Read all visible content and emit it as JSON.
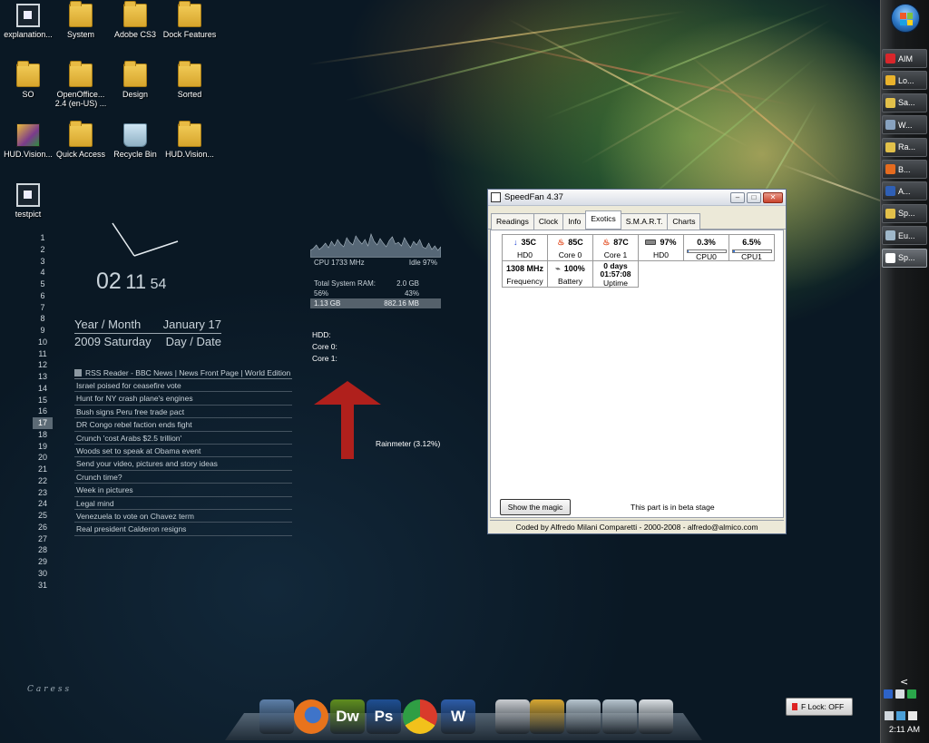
{
  "desktop_icons": [
    {
      "label": "explanation...",
      "type": "screen"
    },
    {
      "label": "System",
      "type": "folder"
    },
    {
      "label": "Adobe CS3",
      "type": "folder"
    },
    {
      "label": "Dock Features",
      "type": "folder"
    },
    {
      "label": "SO",
      "type": "folder"
    },
    {
      "label": "OpenOffice... 2.4 (en-US) ...",
      "type": "folder"
    },
    {
      "label": "Design",
      "type": "folder"
    },
    {
      "label": "Sorted",
      "type": "folder"
    },
    {
      "label": "HUD.Vision...",
      "type": "hud"
    },
    {
      "label": "Quick Access",
      "type": "folder"
    },
    {
      "label": "Recycle Bin",
      "type": "bin"
    },
    {
      "label": "HUD.Vision...",
      "type": "folder"
    },
    {
      "label": "testpict",
      "type": "screen"
    }
  ],
  "calendar": {
    "days": [
      "1",
      "2",
      "3",
      "4",
      "5",
      "6",
      "7",
      "8",
      "9",
      "10",
      "11",
      "12",
      "13",
      "14",
      "15",
      "16",
      "17",
      "18",
      "19",
      "20",
      "21",
      "22",
      "23",
      "24",
      "25",
      "26",
      "27",
      "28",
      "29",
      "30",
      "31"
    ],
    "today": "17"
  },
  "clock": {
    "hours": "02",
    "minutes": "11",
    "seconds": "54"
  },
  "date_widget": {
    "top_left": "Year / Month",
    "top_right": "January 17",
    "bottom_left": "2009 Saturday",
    "bottom_right": "Day / Date"
  },
  "rss": {
    "header": "RSS Reader - BBC News | News Front Page | World Edition",
    "items": [
      "Israel poised for ceasefire vote",
      "Hunt for NY crash plane's engines",
      "Bush signs Peru free trade pact",
      "DR Congo rebel faction ends fight",
      "Crunch 'cost Arabs $2.5 trillion'",
      "Woods set to speak at Obama event",
      "Send your video, pictures and story ideas",
      "Crunch time?",
      "Week in pictures",
      "Legal mind",
      "Venezuela to vote on Chavez term",
      "Real president Calderon resigns"
    ]
  },
  "sysmon": {
    "cpu_label": "CPU 1733 MHz",
    "idle_label": "Idle 97%",
    "ram_label": "Total System RAM:",
    "ram_total": "2.0 GB",
    "ram_left_pct": "56%",
    "ram_right_pct": "43%",
    "ram_used": "1.13 GB",
    "ram_free": "882.16 MB",
    "hdd": "HDD:",
    "core0": "Core 0:",
    "core1": "Core 1:"
  },
  "rainmeter_label": "Rainmeter (3.12%)",
  "speedfan": {
    "title": "SpeedFan 4.37",
    "tabs": [
      "Readings",
      "Clock",
      "Info",
      "Exotics",
      "S.M.A.R.T.",
      "Charts"
    ],
    "active_tab": "Exotics",
    "cells": {
      "hd0_temp": {
        "value": "35C",
        "label": "HD0"
      },
      "core0": {
        "value": "85C",
        "label": "Core 0"
      },
      "core1": {
        "value": "87C",
        "label": "Core 1"
      },
      "hd0_health": {
        "value": "97%",
        "label": "HD0"
      },
      "cpu0": {
        "value": "0.3%",
        "label": "CPU0",
        "level": 0.003
      },
      "cpu1": {
        "value": "6.5%",
        "label": "CPU1",
        "level": 0.065
      },
      "frequency": {
        "value": "1308 MHz",
        "label": "Frequency"
      },
      "battery": {
        "value": "100%",
        "label": "Battery"
      },
      "uptime": {
        "value_line1": "0 days",
        "value_line2": "01:57:08",
        "label": "Uptime"
      }
    },
    "magic_button": "Show the magic",
    "beta_text": "This part is in beta stage",
    "status": "Coded by Alfredo Milani Comparetti - 2000-2008 - alfredo@almico.com"
  },
  "taskbar": {
    "buttons": [
      {
        "label": "AIM",
        "color": "#d9262b"
      },
      {
        "label": "Lo...",
        "color": "#e9b22c"
      },
      {
        "label": "Sa...",
        "color": "#e2c04a"
      },
      {
        "label": "W...",
        "color": "#88a2bf"
      },
      {
        "label": "Ra...",
        "color": "#e2c04a"
      },
      {
        "label": "B...",
        "color": "#e56b1f"
      },
      {
        "label": "A...",
        "color": "#2f5fb5"
      },
      {
        "label": "Sp...",
        "color": "#e2c04a"
      },
      {
        "label": "Eu...",
        "color": "#9fb7c9"
      },
      {
        "label": "Sp...",
        "color": "#ffffff"
      }
    ],
    "active_index": 9,
    "clock": "2:11 AM",
    "chevron": "<"
  },
  "flock": "F Lock: OFF",
  "dock": [
    {
      "name": "preview-icon",
      "text": "",
      "color": "#5d7fa8"
    },
    {
      "name": "firefox-icon",
      "text": "",
      "color": "#e8731c"
    },
    {
      "name": "dreamweaver-icon",
      "text": "Dw",
      "color": "#5f8d1f"
    },
    {
      "name": "photoshop-icon",
      "text": "Ps",
      "color": "#1f4f92"
    },
    {
      "name": "chrome-icon",
      "text": "",
      "color": "#d93b2b"
    },
    {
      "name": "word-icon",
      "text": "W",
      "color": "#2e5da8"
    },
    {
      "name": "presentation-icon",
      "text": "",
      "color": "#c9ccd0"
    },
    {
      "name": "tools-icon",
      "text": "",
      "color": "#d7a733"
    },
    {
      "name": "downloads-folder-icon",
      "text": "",
      "color": "#b6c4ce"
    },
    {
      "name": "folder-icon",
      "text": "",
      "color": "#b6c4ce"
    },
    {
      "name": "documents-icon",
      "text": "",
      "color": "#d9dee2"
    }
  ],
  "caress_logo": "Caress"
}
